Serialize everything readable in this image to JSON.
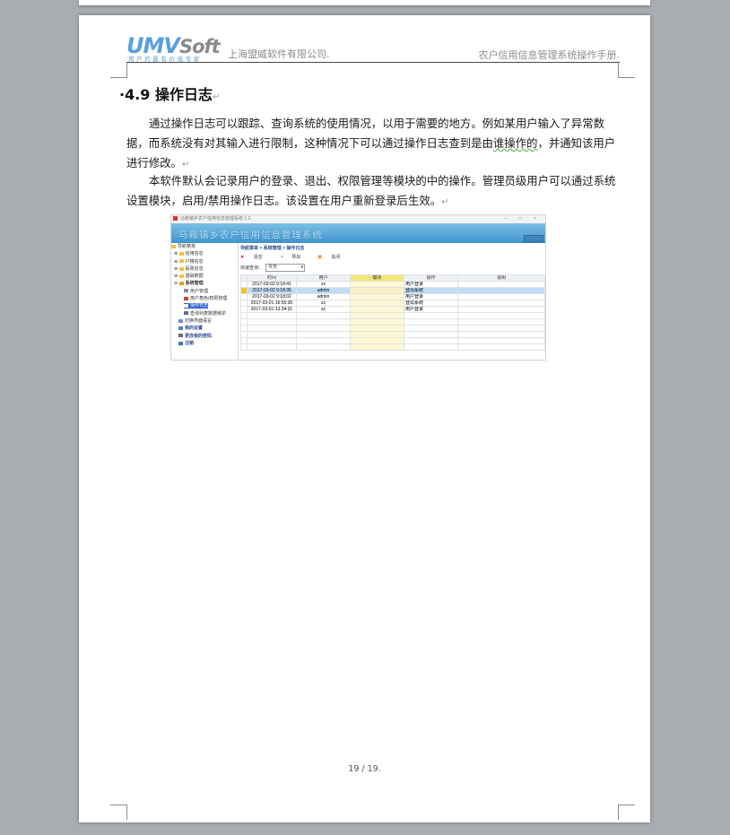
{
  "header": {
    "logo_text": "UMV",
    "logo_soft": "Soft",
    "logo_tagline": "用户的最有价值专家",
    "company": "上海盟威软件有限公司.",
    "manual_title": "农户信用信息管理系统操作手册."
  },
  "section": {
    "number": "4.9",
    "title": "操作日志",
    "return_mark": "↵"
  },
  "paragraphs": {
    "p1_a": "通过操作日志可以跟踪、查询系统的使用情况，以用于需要的地方。例如某用户输入了异常数据，而系统没有对其输入进行限制，这种情况下可以通过操作日志查到是由",
    "p1_b": "谁操作的",
    "p1_c": "，并通知该用户进行修改。",
    "p2": "本软件默认会记录用户的登录、退出、权限管理等模块的中的操作。管理员级用户可以通过系统设置模块，启用/禁用操作日志。该设置在用户重新登录后生效。"
  },
  "screenshot": {
    "window_title": "马鞍镇乡农户信用信息管理系统 1.2",
    "window_controls": "–  □  ×",
    "banner_title": "马鞍镇乡农户信用信息管理系统",
    "nav_header": "导航菜单",
    "nav_items": [
      "信用信息",
      "户籍信息",
      "民政信息",
      "基础数据",
      "系统管理",
      "用户管理",
      "用户角色/权限管理",
      "操作日志",
      "查询列表数据维护",
      "切换界面语言",
      "我的设置",
      "更改我的密码",
      "注销"
    ],
    "breadcrumb": "导航菜单 > 系统管理 > 操作日志",
    "toolbar": {
      "clear": "清空",
      "export": "导出",
      "close": "关闭"
    },
    "quick_query_label": "快速查询：",
    "quick_query_value": "今天",
    "columns": [
      "时间",
      "用户",
      "模块",
      "操作",
      "说明"
    ],
    "rows": [
      {
        "time": "2017-03-02 9:18:41",
        "user": "zz",
        "module": "",
        "action": "用户登录",
        "note": ""
      },
      {
        "time": "2017-03-02 9:18:35",
        "user": "admin",
        "module": "",
        "action": "登出系统",
        "note": ""
      },
      {
        "time": "2017-03-02 9:18:02",
        "user": "admin",
        "module": "",
        "action": "用户登录",
        "note": ""
      },
      {
        "time": "2017-03-01 16:55:36",
        "user": "zz",
        "module": "",
        "action": "登出系统",
        "note": ""
      },
      {
        "time": "2017-03-01 13:34:31",
        "user": "zz",
        "module": "",
        "action": "用户登录",
        "note": ""
      }
    ]
  },
  "footer": {
    "page_number": "19 / 19."
  }
}
